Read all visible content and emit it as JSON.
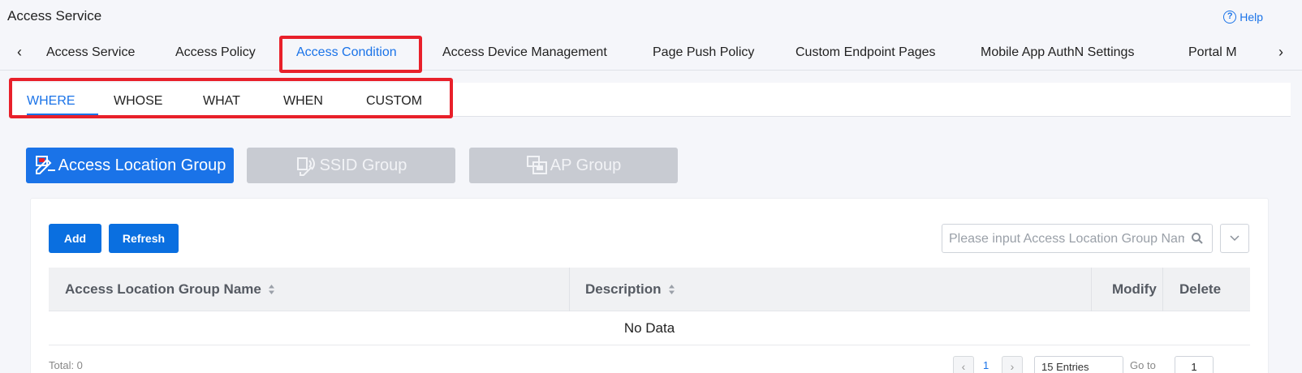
{
  "header": {
    "title": "Access Service",
    "help_label": "Help",
    "help_icon_glyph": "?"
  },
  "tabs": [
    {
      "label": "Access Service"
    },
    {
      "label": "Access Policy"
    },
    {
      "label": "Access Condition",
      "active": true
    },
    {
      "label": "Access Device Management"
    },
    {
      "label": "Page Push Policy"
    },
    {
      "label": "Custom Endpoint Pages"
    },
    {
      "label": "Mobile App AuthN Settings"
    },
    {
      "label": "Portal M"
    }
  ],
  "tab_arrows": {
    "left": "‹",
    "right": "›"
  },
  "subtabs": [
    {
      "label": "WHERE",
      "active": true
    },
    {
      "label": "WHOSE"
    },
    {
      "label": "WHAT"
    },
    {
      "label": "WHEN"
    },
    {
      "label": "CUSTOM"
    }
  ],
  "group_buttons": [
    {
      "label": "Access Location Group",
      "icon": "location-edit-icon",
      "active": true
    },
    {
      "label": "SSID Group",
      "icon": "ssid-icon",
      "active": false
    },
    {
      "label": "AP Group",
      "icon": "ap-group-icon",
      "active": false
    }
  ],
  "toolbar": {
    "add_label": "Add",
    "refresh_label": "Refresh",
    "search_placeholder": "Please input Access Location Group Name"
  },
  "table": {
    "columns": [
      "Access Location Group Name",
      "Description",
      "Modify",
      "Delete"
    ],
    "empty_text": "No Data"
  },
  "footer": {
    "total": "Total: 0",
    "prev": "‹",
    "page": "1",
    "next": "›",
    "page_size": "15 Entries",
    "goto_label": "Go to",
    "goto_value": "1"
  },
  "colors": {
    "accent": "#1a73e8",
    "highlight": "#e8202a",
    "inactive_button": "#c8cbd2"
  }
}
